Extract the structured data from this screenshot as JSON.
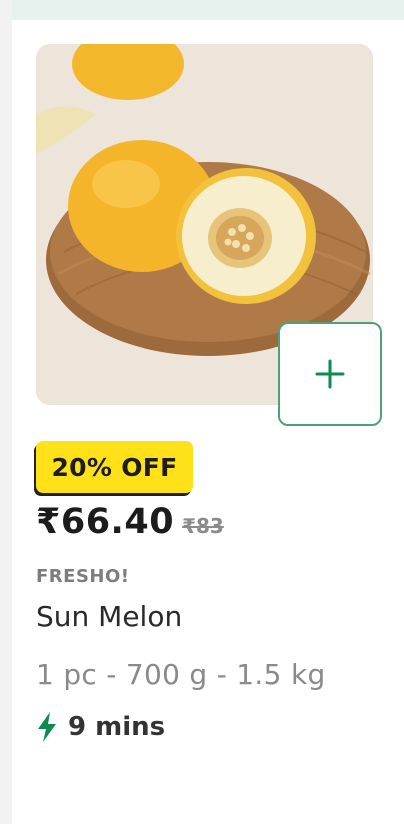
{
  "product": {
    "discount_badge": "20% OFF",
    "price": "₹66.40",
    "mrp": "₹83",
    "brand": "FRESHO!",
    "name": "Sun Melon",
    "quantity": "1 pc - 700 g - 1.5 kg",
    "delivery_time": "9 mins",
    "image_icon": "melon-product-image"
  },
  "actions": {
    "add_icon": "plus-icon"
  },
  "colors": {
    "accent_green": "#0c8a4f",
    "badge_yellow": "#ffe11a",
    "add_border": "#4f9f7c"
  }
}
